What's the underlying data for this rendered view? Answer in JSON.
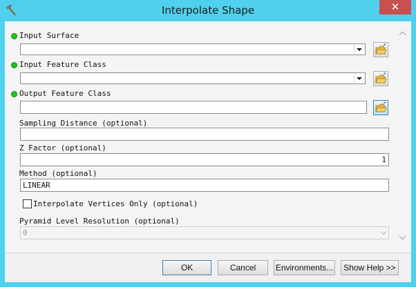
{
  "window": {
    "title": "Interpolate Shape",
    "close_glyph": "✕",
    "app_icon": "hammer-icon"
  },
  "params": {
    "input_surface": {
      "label": "Input Surface",
      "value": ""
    },
    "input_feature_class": {
      "label": "Input Feature Class",
      "value": ""
    },
    "output_feature_class": {
      "label": "Output Feature Class",
      "value": ""
    },
    "sampling_distance": {
      "label": "Sampling Distance (optional)",
      "value": ""
    },
    "z_factor": {
      "label": "Z Factor (optional)",
      "value": "1"
    },
    "method": {
      "label": "Method (optional)",
      "value": "LINEAR"
    },
    "interpolate_vertices_only": {
      "label": "Interpolate Vertices Only (optional)",
      "checked": false
    },
    "pyramid_level_resolution": {
      "label": "Pyramid Level Resolution (optional)",
      "value": "0"
    }
  },
  "buttons": {
    "ok": "OK",
    "cancel": "Cancel",
    "environments": "Environments...",
    "show_help": "Show Help >>"
  },
  "colors": {
    "title_bar": "#4fd1ee",
    "close_button": "#c75050",
    "required_dot": "#22c322"
  }
}
